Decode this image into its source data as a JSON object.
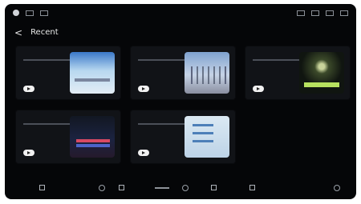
{
  "statusbar": {
    "left_icons": [
      "circle-icon",
      "square-icon",
      "square-icon"
    ],
    "center_text": "",
    "right_icons": [
      "wifi-icon",
      "signal-icon",
      "battery-icon",
      "menu-icon"
    ]
  },
  "header": {
    "back_label": "<",
    "title": "Recent"
  },
  "cards": [
    {
      "title": "",
      "subtitle": "",
      "theme": "t1",
      "play": true
    },
    {
      "title": "",
      "subtitle": "",
      "theme": "t2",
      "play": true
    },
    {
      "title": "",
      "subtitle": "",
      "theme": "t3",
      "play": true
    },
    {
      "title": "",
      "subtitle": "",
      "theme": "t4",
      "play": true
    },
    {
      "title": "",
      "subtitle": "",
      "theme": "t5",
      "play": true
    }
  ],
  "navbar": {
    "items": [
      "home-icon",
      "media-icon",
      "playlist-icon",
      "controls-icon",
      "music-icon",
      "queue-icon",
      "volume-icon",
      "settings-icon"
    ]
  }
}
